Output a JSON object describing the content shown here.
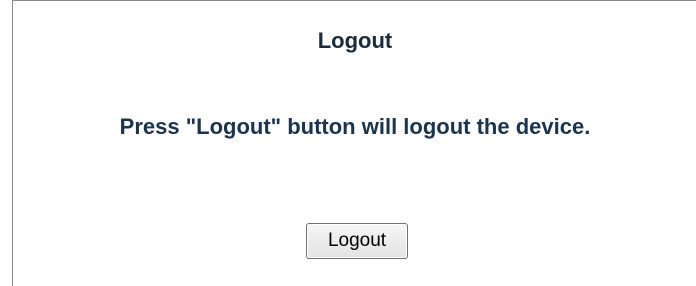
{
  "title": "Logout",
  "message": "Press \"Logout\" button will logout the device.",
  "logout_button_label": "Logout"
}
